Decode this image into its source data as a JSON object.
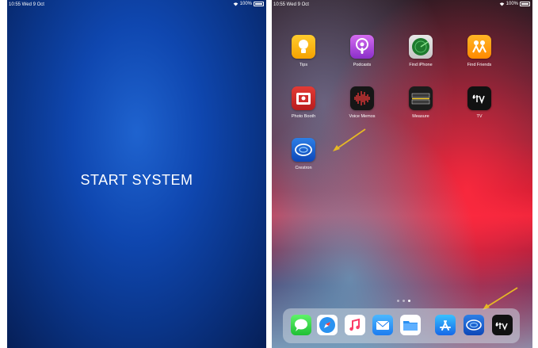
{
  "left_screen": {
    "status_time": "10:55  Wed 9 Oct",
    "battery": "100%",
    "start_label": "START SYSTEM"
  },
  "right_screen": {
    "status_time": "10:55  Wed 9 Oct",
    "battery": "100%",
    "apps": [
      {
        "label": "Tips",
        "icon": "tips-icon"
      },
      {
        "label": "Podcasts",
        "icon": "podcasts-icon"
      },
      {
        "label": "Find iPhone",
        "icon": "find-iphone-icon"
      },
      {
        "label": "Find Friends",
        "icon": "find-friends-icon"
      },
      {
        "label": "Photo Booth",
        "icon": "photo-booth-icon"
      },
      {
        "label": "Voice Memos",
        "icon": "voice-memos-icon"
      },
      {
        "label": "Measure",
        "icon": "measure-icon"
      },
      {
        "label": "TV",
        "icon": "tv-icon"
      },
      {
        "label": "Crestron",
        "icon": "crestron-icon"
      }
    ],
    "dock": [
      "messages-icon",
      "safari-icon",
      "music-icon",
      "mail-icon",
      "files-icon",
      "app-store-icon",
      "crestron-icon",
      "tv-icon"
    ],
    "page_indicator": {
      "count": 3,
      "active": 2
    }
  },
  "colors": {
    "annotation_arrow": "#e6b825",
    "left_bg": "#0f47b0"
  }
}
